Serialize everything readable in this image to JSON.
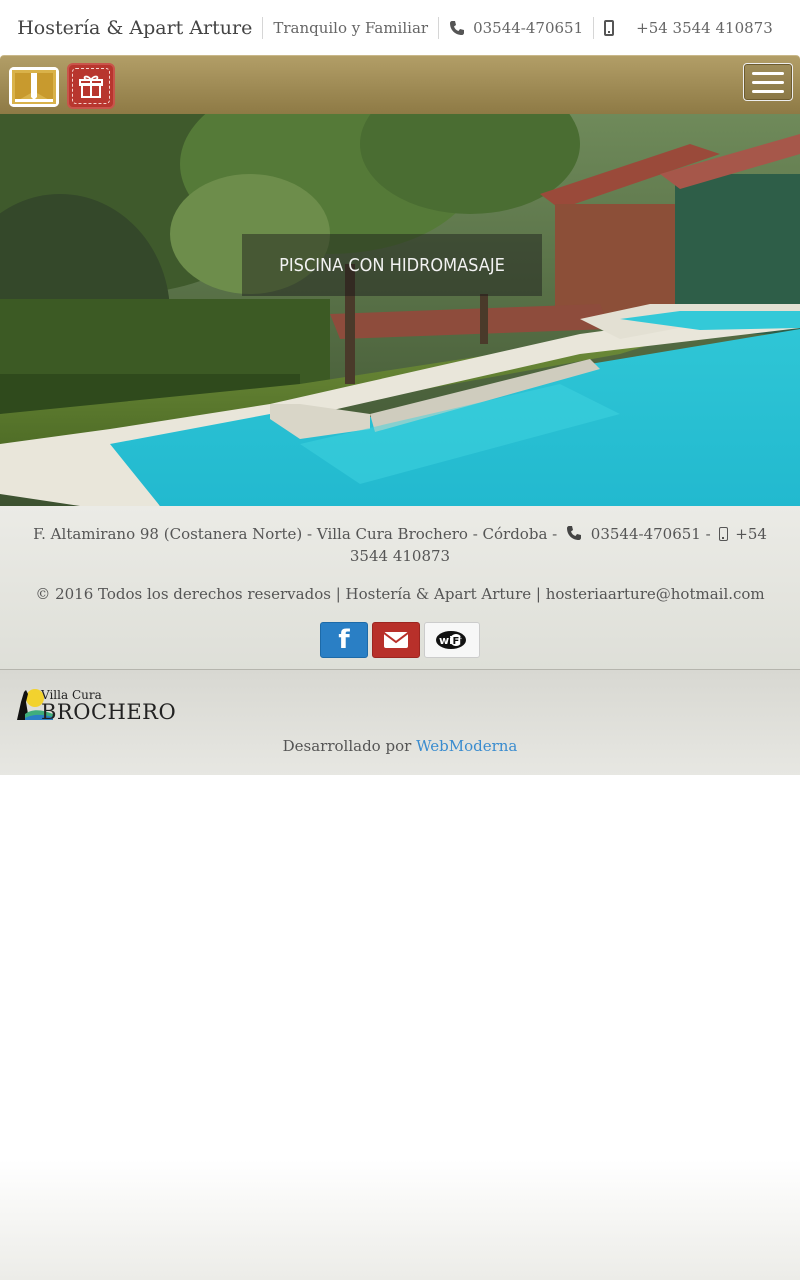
{
  "topbar": {
    "brand": "Hostería & Apart Arture",
    "tagline": "Tranquilo y Familiar",
    "phone": "03544-470651",
    "mobile": "+54 3544 410873"
  },
  "navbar": {
    "logo_icon": "hotel-logo-icon",
    "gift_icon": "gift-icon",
    "menu_icon": "hamburger-menu-icon"
  },
  "hero": {
    "caption": "PISCINA CON HIDROMASAJE"
  },
  "footer": {
    "address": "F. Altamirano 98 (Costanera Norte) - Villa Cura Brochero - Córdoba -",
    "phone": "03544-470651",
    "separator": "-",
    "mobile": "+54 3544 410873",
    "copyright": "© 2016 Todos los derechos reservados | Hostería & Apart Arture | hosteriaarture@hotmail.com",
    "social": [
      "facebook-icon",
      "email-icon",
      "wifi-icon"
    ]
  },
  "subfooter": {
    "logo_small": "Villa Cura",
    "logo_big": "BROCHERO",
    "developed_by": "Desarrollado por",
    "developer": "WebModerna"
  },
  "colors": {
    "nav_gold": "#9e8a55",
    "gift_red": "#b8362e",
    "facebook_blue": "#2a7fc5",
    "mail_red": "#b8302a",
    "link_blue": "#3a8ccf"
  }
}
